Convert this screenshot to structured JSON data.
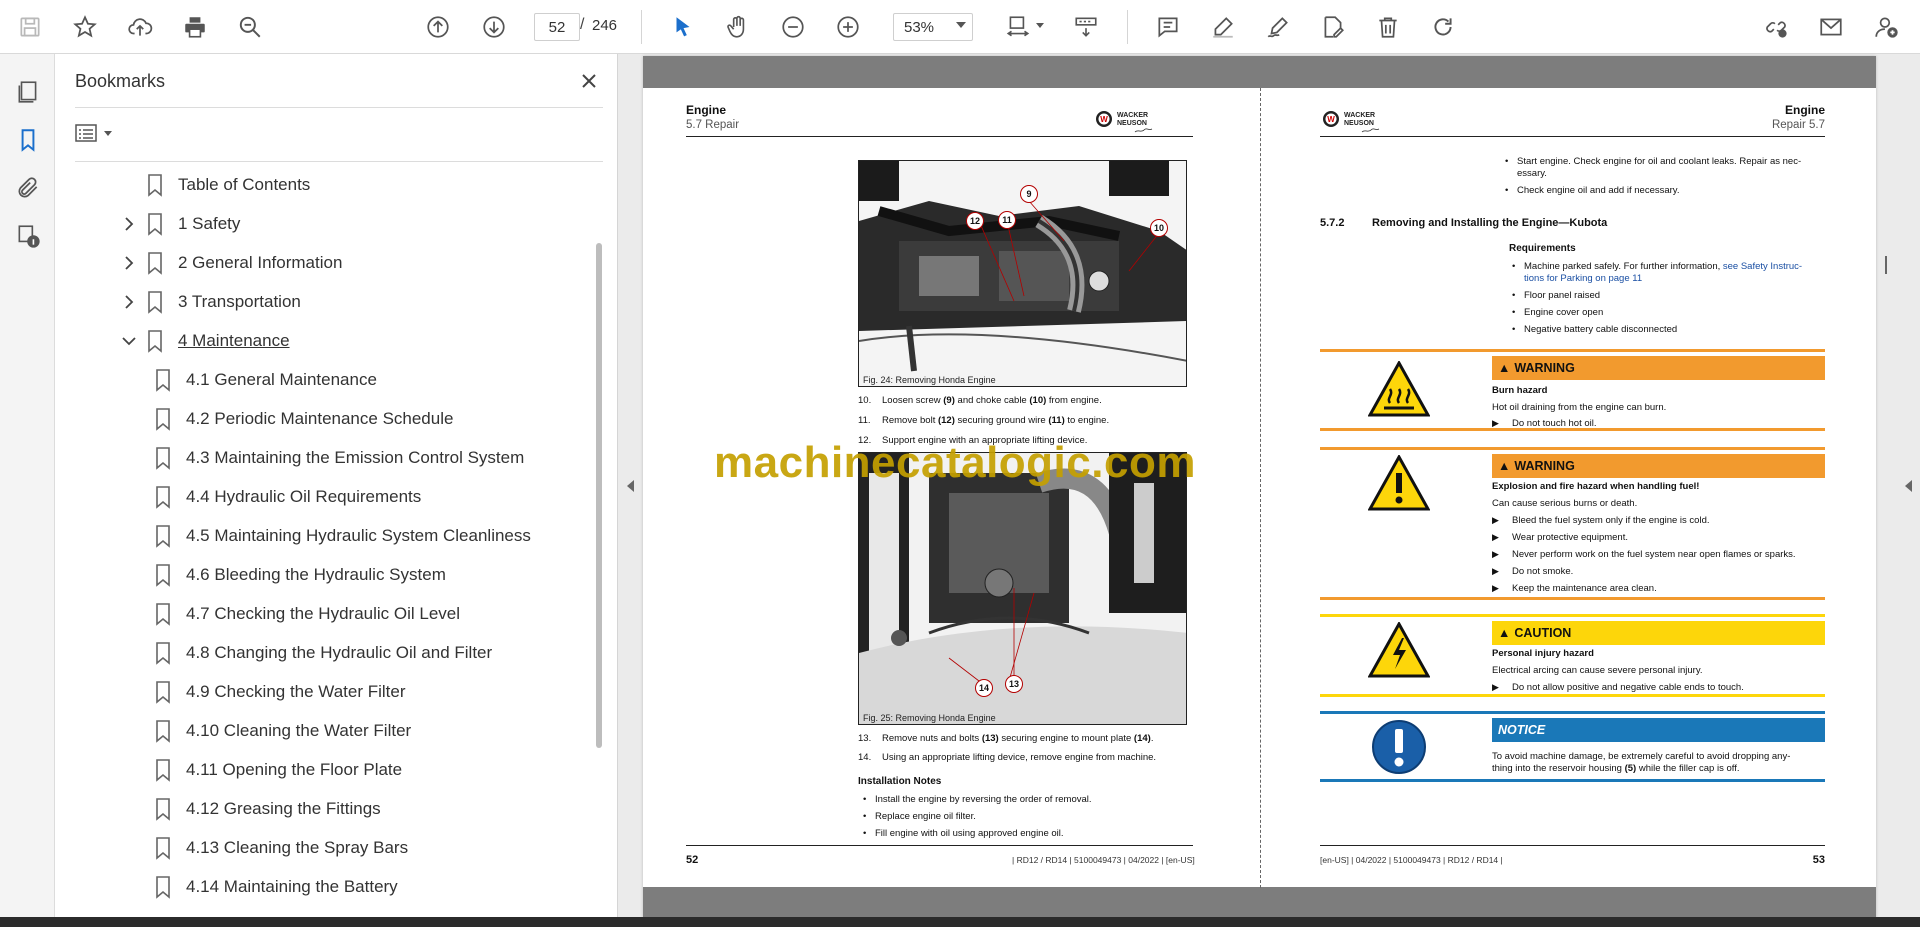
{
  "toolbar": {
    "current_page": "52",
    "page_separator": "/",
    "total_pages": "246",
    "zoom": "53%"
  },
  "bookmarks_panel": {
    "title": "Bookmarks",
    "items": [
      {
        "label": "Table of Contents",
        "level": 0,
        "expander": "none"
      },
      {
        "label": "1 Safety",
        "level": 0,
        "expander": "collapsed"
      },
      {
        "label": "2 General Information",
        "level": 0,
        "expander": "collapsed"
      },
      {
        "label": "3 Transportation",
        "level": 0,
        "expander": "collapsed"
      },
      {
        "label": "4 Maintenance",
        "level": 0,
        "expander": "expanded"
      },
      {
        "label": "4.1 General Maintenance",
        "level": 1,
        "expander": "none"
      },
      {
        "label": "4.2 Periodic Maintenance Schedule",
        "level": 1,
        "expander": "none"
      },
      {
        "label": "4.3 Maintaining the Emission Control System",
        "level": 1,
        "expander": "none"
      },
      {
        "label": "4.4 Hydraulic Oil Requirements",
        "level": 1,
        "expander": "none"
      },
      {
        "label": "4.5 Maintaining Hydraulic System Cleanliness",
        "level": 1,
        "expander": "none"
      },
      {
        "label": "4.6 Bleeding the Hydraulic System",
        "level": 1,
        "expander": "none"
      },
      {
        "label": "4.7 Checking the Hydraulic Oil Level",
        "level": 1,
        "expander": "none"
      },
      {
        "label": "4.8 Changing the Hydraulic Oil and Filter",
        "level": 1,
        "expander": "none"
      },
      {
        "label": "4.9 Checking the Water Filter",
        "level": 1,
        "expander": "none"
      },
      {
        "label": "4.10 Cleaning the Water Filter",
        "level": 1,
        "expander": "none"
      },
      {
        "label": "4.11 Opening the Floor Plate",
        "level": 1,
        "expander": "none"
      },
      {
        "label": "4.12 Greasing the Fittings",
        "level": 1,
        "expander": "none"
      },
      {
        "label": "4.13 Cleaning the Spray Bars",
        "level": 1,
        "expander": "none"
      },
      {
        "label": "4.14 Maintaining the Battery",
        "level": 1,
        "expander": "none"
      }
    ]
  },
  "watermark": "machinecatalogic.com",
  "left_page": {
    "header_title": "Engine",
    "header_sub": "5.7 Repair",
    "logo_text": "WACKER NEUSON",
    "fig1": {
      "caption": "Fig. 24: Removing Honda Engine",
      "callouts": [
        "9",
        "10",
        "11",
        "12"
      ]
    },
    "steps_a": [
      {
        "n": "10.",
        "pre": "Loosen screw ",
        "b1": "(9)",
        "mid": " and choke cable ",
        "b2": "(10)",
        "post": " from engine."
      },
      {
        "n": "11.",
        "pre": "Remove bolt ",
        "b1": "(12)",
        "mid": " securing ground wire ",
        "b2": "(11)",
        "post": " to engine."
      },
      {
        "n": "12.",
        "pre": "Support engine with an appropriate lifting device.",
        "b1": "",
        "mid": "",
        "b2": "",
        "post": ""
      }
    ],
    "fig2": {
      "caption": "Fig. 25: Removing Honda Engine",
      "callouts": [
        "13",
        "14"
      ]
    },
    "steps_b": [
      {
        "n": "13.",
        "pre": "Remove nuts and bolts ",
        "b1": "(13)",
        "mid": " securing engine to mount plate ",
        "b2": "(14)",
        "post": "."
      },
      {
        "n": "14.",
        "pre": "Using an appropriate lifting device, remove engine from machine.",
        "b1": "",
        "mid": "",
        "b2": "",
        "post": ""
      }
    ],
    "install_heading": "Installation Notes",
    "install_notes": [
      "Install the engine by reversing the order of removal.",
      "Replace engine oil filter.",
      "Fill engine with oil using approved engine oil."
    ],
    "page_number": "52",
    "footer": "| RD12 / RD14 | 5100049473 | 04/2022 | [en-US]"
  },
  "right_page": {
    "header_title": "Engine",
    "header_sub": "Repair 5.7",
    "logo_text": "WACKER NEUSON",
    "top_bullets": [
      "Start engine. Check engine for oil and coolant leaks. Repair as nec-",
      "essary.",
      "Check engine oil and add if necessary."
    ],
    "section_number": "5.7.2",
    "section_title": "Removing and Installing the Engine—Kubota",
    "requirements_heading": "Requirements",
    "requirements": {
      "r1_text": "Machine parked safely. For further information, ",
      "r1_link": "see Safety Instruc-",
      "r1_link2": "tions for Parking on page 11",
      "r2": "Floor panel raised",
      "r3": "Engine cover open",
      "r4": "Negative battery cable disconnected"
    },
    "hazards": [
      {
        "type": "WARNING",
        "color": "#f29a2e",
        "title": "Burn hazard",
        "desc": "Hot oil draining from the engine can burn.",
        "actions": [
          "Do not touch hot oil."
        ]
      },
      {
        "type": "WARNING",
        "color": "#f29a2e",
        "title": "Explosion and fire hazard when handling fuel!",
        "desc": "Can cause serious burns or death.",
        "actions": [
          "Bleed the fuel system only if the engine is cold.",
          "Wear protective equipment.",
          "Never perform work on the fuel system near open flames or sparks.",
          "Do not smoke.",
          "Keep the maintenance area clean."
        ]
      },
      {
        "type": "CAUTION",
        "color": "#fdd60a",
        "title": "Personal injury hazard",
        "desc": "Electrical arcing can cause severe personal injury.",
        "actions": [
          "Do not allow positive and negative cable ends to touch."
        ]
      }
    ],
    "notice": {
      "type": "NOTICE",
      "color": "#1a78b8",
      "line1": "To avoid machine damage, be extremely careful to avoid dropping any-",
      "line2_pre": "thing into the reservoir housing ",
      "line2_b": "(5)",
      "line2_post": " while the filler cap is off."
    },
    "page_number": "53",
    "footer": "[en-US] | 04/2022 | 5100049473 | RD12 / RD14 |"
  }
}
